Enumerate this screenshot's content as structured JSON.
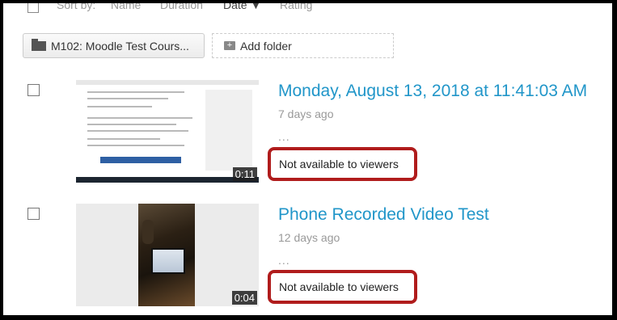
{
  "sort_bar": {
    "label": "Sort by:",
    "options": [
      "Name",
      "Duration",
      "Date ▼",
      "Rating"
    ]
  },
  "toolbar": {
    "folder_label": "M102: Moodle Test Cours...",
    "add_folder_label": "Add folder"
  },
  "videos": [
    {
      "title": "Monday, August 13, 2018 at 11:41:03 AM",
      "age": "7 days ago",
      "more": "...",
      "availability": "Not available to viewers",
      "duration": "0:11"
    },
    {
      "title": "Phone Recorded Video Test",
      "age": "12 days ago",
      "more": "...",
      "availability": "Not available to viewers",
      "duration": "0:04"
    }
  ],
  "colors": {
    "title_link": "#2196c9",
    "highlight_border": "#b01c1c",
    "frame_border": "#000000"
  }
}
